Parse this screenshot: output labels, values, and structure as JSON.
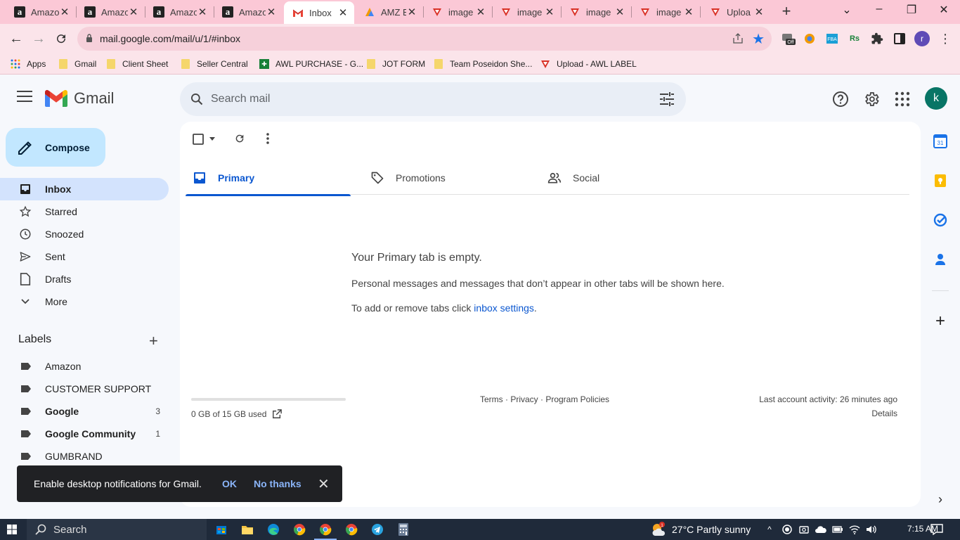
{
  "browser": {
    "tabs": [
      {
        "title": "Amazo",
        "icon": "amazon-icon"
      },
      {
        "title": "Amazo",
        "icon": "amazon-icon"
      },
      {
        "title": "Amazo",
        "icon": "amazon-icon"
      },
      {
        "title": "Amazo",
        "icon": "amazon-icon"
      },
      {
        "title": "Inbox",
        "icon": "gmail-icon",
        "active": true
      },
      {
        "title": "AMZ E",
        "icon": "amz-tool-icon"
      },
      {
        "title": "image",
        "icon": "awl-icon"
      },
      {
        "title": "image",
        "icon": "awl-icon"
      },
      {
        "title": "image",
        "icon": "awl-icon"
      },
      {
        "title": "image",
        "icon": "awl-icon"
      },
      {
        "title": "Uploa",
        "icon": "awl-icon"
      }
    ],
    "url": "mail.google.com/mail/u/1/#inbox",
    "profile_initial": "r",
    "extension_badge": "Off",
    "bookmarks": [
      {
        "label": "Apps",
        "icon": "apps-grid-icon"
      },
      {
        "label": "Gmail",
        "icon": "folder-icon"
      },
      {
        "label": "Client Sheet",
        "icon": "folder-icon"
      },
      {
        "label": "Seller Central",
        "icon": "folder-icon"
      },
      {
        "label": "AWL PURCHASE - G...",
        "icon": "sheets-icon"
      },
      {
        "label": "JOT FORM",
        "icon": "folder-icon"
      },
      {
        "label": "Team Poseidon She...",
        "icon": "folder-icon"
      },
      {
        "label": "Upload - AWL LABEL",
        "icon": "awl-icon"
      }
    ]
  },
  "gmail": {
    "wordmark": "Gmail",
    "search": {
      "placeholder": "Search mail"
    },
    "avatar_initial": "k",
    "compose_label": "Compose",
    "nav": [
      {
        "label": "Inbox",
        "icon": "inbox-icon",
        "active": true
      },
      {
        "label": "Starred",
        "icon": "star-icon"
      },
      {
        "label": "Snoozed",
        "icon": "clock-icon"
      },
      {
        "label": "Sent",
        "icon": "send-icon"
      },
      {
        "label": "Drafts",
        "icon": "draft-icon"
      },
      {
        "label": "More",
        "icon": "chevron-down-icon"
      }
    ],
    "labels_heading": "Labels",
    "labels": [
      {
        "name": "Amazon",
        "count": ""
      },
      {
        "name": "CUSTOMER SUPPORT",
        "count": ""
      },
      {
        "name": "Google",
        "count": "3",
        "bold": true
      },
      {
        "name": "Google Community",
        "count": "1",
        "bold": true
      },
      {
        "name": "GUMBRAND",
        "count": ""
      }
    ],
    "category_tabs": [
      {
        "label": "Primary",
        "icon": "inbox-tray-icon",
        "active": true
      },
      {
        "label": "Promotions",
        "icon": "tag-icon"
      },
      {
        "label": "Social",
        "icon": "people-icon"
      }
    ],
    "empty": {
      "title": "Your Primary tab is empty.",
      "description": "Personal messages and messages that don’t appear in other tabs will be shown here.",
      "settings_prefix": "To add or remove tabs click ",
      "settings_link": "inbox settings",
      "settings_suffix": "."
    },
    "storage": {
      "text": "0 GB of 15 GB used",
      "used_fraction": 0
    },
    "footer_links": "Terms · Privacy · Program Policies",
    "activity": "Last account activity: 26 minutes ago",
    "details": "Details",
    "toast": {
      "message": "Enable desktop notifications for Gmail.",
      "ok": "OK",
      "no_thanks": "No thanks"
    },
    "colors": {
      "accent": "#0b57d0",
      "compose_bg": "#c2e7ff",
      "active_nav_bg": "#d3e3fd",
      "avatar_bg": "#087566"
    }
  },
  "taskbar": {
    "search": "Search",
    "weather": "27°C  Partly sunny",
    "weather_badge": "1",
    "time": "7:15 AM"
  }
}
